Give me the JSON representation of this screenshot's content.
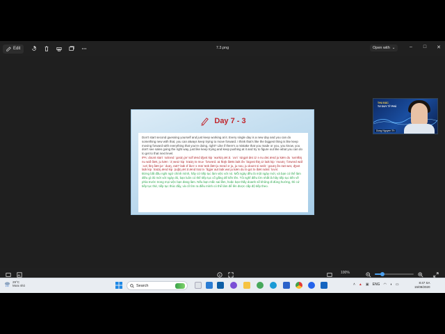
{
  "toolbar": {
    "edit_label": "Edit",
    "filename": "7.3.png",
    "open_with_label": "Open with",
    "icons": [
      "rotate-icon",
      "delete-icon",
      "print-icon",
      "copy-icon",
      "more-icon"
    ]
  },
  "window_controls": {
    "minimize": "–",
    "maximize": "□",
    "close": "✕"
  },
  "slide": {
    "title": "Day 7 - 3",
    "paragraph_en": "Don't start second guessing yourself and just keep working at it. Every single day is a new day and you can do something new with that, you can always keep trying to move forward. I think that's like the biggest thing is like keep moving forward with everything that you're doing, right? Like if there's a mistake that you made or you, you know, you don't see sales going the right way, just like keep trying and keep pushing at it and try to figure out like what you can do to get to that next level.",
    "paragraph_ipa": "IPA: doʊnt stɑrt ˈsɛkənd ˈgɛsɪŋ jərˈsɛlf ænd ʤʌst kip ˈwɜrkɪŋ æt ɪt. ˈɛvri ˈsɪŋgəl deɪ ɪz ə nu deɪ ænd ju kæn du ˈsʌmθɪŋ nu wɪð ðæt, ju kæn ˈɔlˌweɪz kip ˈtraɪɪŋ tə muv ˈfɔrwərd. aɪ θɪŋk ðæts laɪk ðə ˈbɪgəst θɪŋ ɪz laɪk kip ˈmuvɪŋ ˈfɔrwərd wɪð ˈɛvriˌθɪŋ ðæt jʊr ˈduɪŋ, raɪt? laɪk ɪf ðɛrz ə mɪsˈteɪk ðæt ju meɪd ɔr ju, ju noʊ, ju doʊnt si seɪlz ˈgoʊɪŋ ðə raɪt weɪ, ʤʌst laɪk kip ˈtraɪɪŋ ænd kip ˈpʊʃɪŋ æt ɪt ænd traɪ tə ˈfɪgjər aʊt laɪk wʌt ju kæn du tə gɛt tə ðæt nɛkst ˈlɛvəl.",
    "paragraph_vi": "Đừng bắt đầu nghi ngờ chính mình, hãy cứ tiếp tục làm việc với nó. Mỗi ngày đều là một ngày mới, và bạn có thể làm điều gì đó mới với ngày đó, bạn luôn có thể tiếp tục cố gắng để tiến lên. Tôi nghĩ điều lớn nhất là hãy tiếp tục tiến về phía trước trong mọi việc bạn đang làm. Nếu bạn mắc sai lầm, hoặc bạn thấy doanh số không đi đúng hướng, thì cứ tiếp tục thử, tiếp tục thúc đẩy, và cố tìm ra điều mình có thể làm để lên được cấp độ tiếp theo."
  },
  "webcam": {
    "banner_line1": "THU ĐẮC",
    "banner_line2": "TƯ DUY TỶ PHÚ",
    "name": "Dung Nguyen Th"
  },
  "statusbar": {
    "zoom_percent": "100%",
    "zoom_level": 0.2
  },
  "taskbar": {
    "weather_temp": "29°C",
    "weather_desc": "Mưa nhỏ",
    "search_label": "Search",
    "language": "ENG",
    "time": "8:47 SA",
    "date": "15/09/2020"
  },
  "colors": {
    "title_red": "#c0262d",
    "ipa_red": "#b02a2f",
    "vi_green": "#2fa84f",
    "accent_blue": "#4aa0f0"
  }
}
